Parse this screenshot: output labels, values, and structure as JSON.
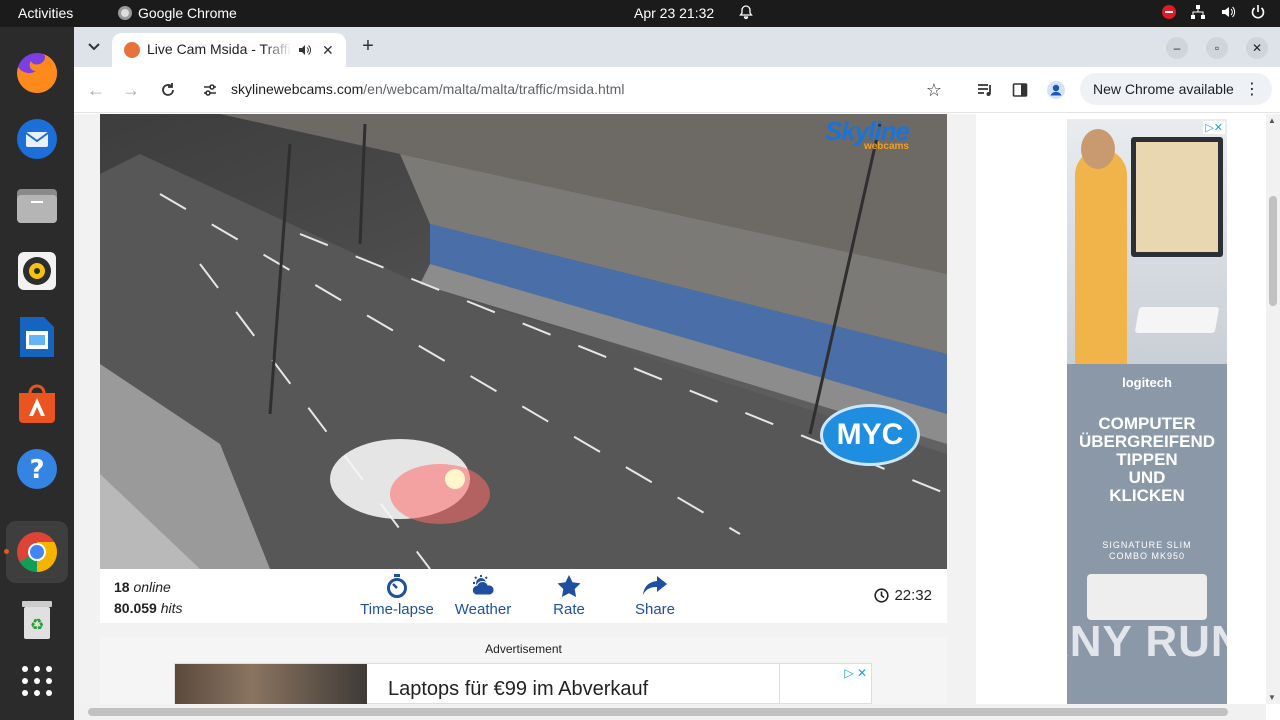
{
  "system": {
    "activities": "Activities",
    "app_name": "Google Chrome",
    "clock": "Apr 23  21:32"
  },
  "browser": {
    "tab_title": "Live Cam Msida - Traffic",
    "new_tab": "+",
    "url_domain": "skylinewebcams.com",
    "url_path": "/en/webcam/malta/malta/traffic/msida.html",
    "update_button": "New Chrome available",
    "update_menu": "⋮"
  },
  "webcam": {
    "logo": "Skyline",
    "logo_sub": "webcams",
    "overlay_brand": "MYC",
    "online_count": "18",
    "online_label": "online",
    "hits_count": "80.059",
    "hits_label": "hits",
    "actions": [
      {
        "label": "Time-lapse",
        "icon": "stopwatch-icon"
      },
      {
        "label": "Weather",
        "icon": "weather-icon"
      },
      {
        "label": "Rate",
        "icon": "star-icon"
      },
      {
        "label": "Share",
        "icon": "share-icon"
      }
    ],
    "local_time": "22:32"
  },
  "ad": {
    "label": "Advertisement",
    "headline": "Laptops für €99 im Abverkauf",
    "choices": "▷ ✕"
  },
  "sidebar_ad": {
    "brand": "logitech",
    "headline_lines": [
      "COMPUTER",
      "ÜBERGREIFEND",
      "TIPPEN",
      "UND",
      "KLICKEN"
    ],
    "product_lines": [
      "SIGNATURE SLIM",
      "COMBO MK950"
    ],
    "close": "▷✕"
  },
  "watermark": "ANY RUN",
  "colors": {
    "accent_blue": "#1f4fa0",
    "topbar": "#1b1b1b",
    "dock": "#2b2b2b",
    "tabbar": "#dee3ea",
    "ubuntu_orange": "#e95420"
  }
}
